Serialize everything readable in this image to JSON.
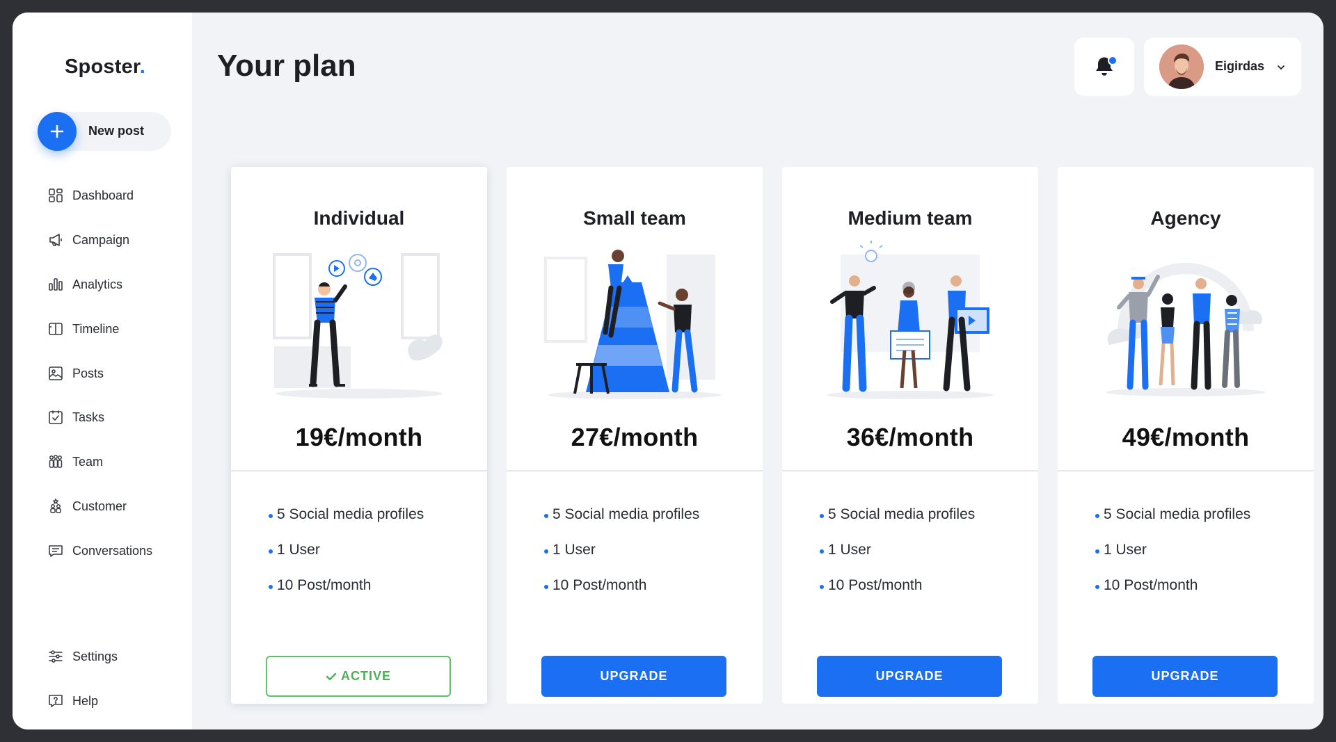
{
  "app": {
    "logo": "Sposter",
    "logo_dot": ".",
    "accent_color": "#1a6ff2",
    "success_color": "#4caf58"
  },
  "sidebar": {
    "new_post_label": "New post",
    "items": [
      {
        "label": "Dashboard",
        "icon": "dashboard-icon"
      },
      {
        "label": "Campaign",
        "icon": "megaphone-icon"
      },
      {
        "label": "Analytics",
        "icon": "bar-chart-icon"
      },
      {
        "label": "Timeline",
        "icon": "timeline-icon"
      },
      {
        "label": "Posts",
        "icon": "image-post-icon"
      },
      {
        "label": "Tasks",
        "icon": "checkbox-icon"
      },
      {
        "label": "Team",
        "icon": "team-icon"
      },
      {
        "label": "Customer",
        "icon": "customer-icon"
      },
      {
        "label": "Conversations",
        "icon": "chat-icon"
      }
    ],
    "bottom_items": [
      {
        "label": "Settings",
        "icon": "sliders-icon"
      },
      {
        "label": "Help",
        "icon": "help-icon"
      }
    ]
  },
  "header": {
    "title": "Your plan",
    "user": {
      "name": "Eigirdas"
    },
    "notifications": {
      "unread": true
    }
  },
  "plans": [
    {
      "name": "Individual",
      "price": "19€/month",
      "features": [
        "5 Social media profiles",
        "1 User",
        "10 Post/month"
      ],
      "button": "ACTIVE",
      "is_active": true
    },
    {
      "name": "Small team",
      "price": "27€/month",
      "features": [
        "5 Social media profiles",
        "1 User",
        "10 Post/month"
      ],
      "button": "UPGRADE",
      "is_active": false
    },
    {
      "name": "Medium team",
      "price": "36€/month",
      "features": [
        "5 Social media profiles",
        "1 User",
        "10 Post/month"
      ],
      "button": "UPGRADE",
      "is_active": false
    },
    {
      "name": "Agency",
      "price": "49€/month",
      "features": [
        "5 Social media profiles",
        "1 User",
        "10 Post/month"
      ],
      "button": "UPGRADE",
      "is_active": false
    }
  ]
}
